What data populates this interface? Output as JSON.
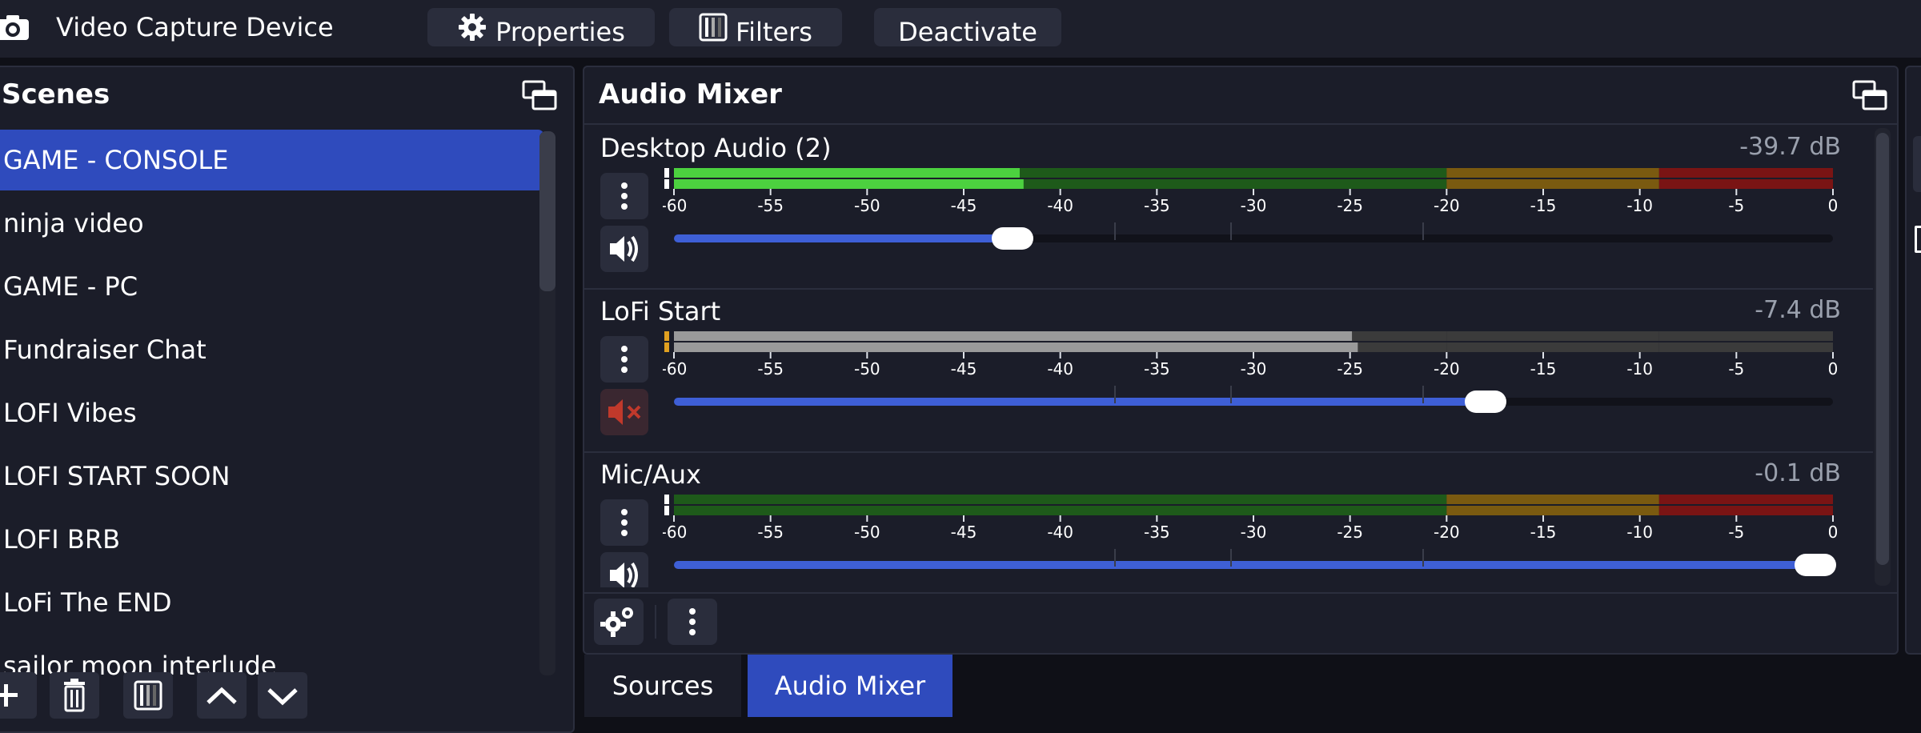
{
  "topbar": {
    "source_name": "Video Capture Device",
    "properties_label": "Properties",
    "filters_label": "Filters",
    "deactivate_label": "Deactivate"
  },
  "scenes": {
    "title": "Scenes",
    "items": [
      {
        "label": "GAME - CONSOLE",
        "selected": true
      },
      {
        "label": "ninja video",
        "selected": false
      },
      {
        "label": "GAME - PC",
        "selected": false
      },
      {
        "label": "Fundraiser Chat",
        "selected": false
      },
      {
        "label": "LOFI Vibes",
        "selected": false
      },
      {
        "label": "LOFI START SOON",
        "selected": false
      },
      {
        "label": "LOFI BRB",
        "selected": false
      },
      {
        "label": "LoFi The END",
        "selected": false
      },
      {
        "label": "sailor moon interlude",
        "selected": false
      }
    ]
  },
  "mixer": {
    "title": "Audio Mixer",
    "scale": [
      "-60",
      "-55",
      "-50",
      "-45",
      "-40",
      "-35",
      "-30",
      "-25",
      "-20",
      "-15",
      "-10",
      "-5",
      "0"
    ],
    "channels": [
      {
        "name": "Desktop Audio (2)",
        "db": "-39.7 dB",
        "muted": false,
        "level1_db": -42.1,
        "level2_db": -41.9,
        "volume_fraction": 0.292
      },
      {
        "name": "LoFi Start",
        "db": "-7.4 dB",
        "muted": true,
        "level1_db": -24.9,
        "level2_db": -24.6,
        "volume_fraction": 0.7
      },
      {
        "name": "Mic/Aux",
        "db": "-0.1 dB",
        "muted": false,
        "level1_db": -60,
        "level2_db": -60,
        "volume_fraction": 0.985
      }
    ]
  },
  "tabs": [
    {
      "label": "Sources",
      "active": false
    },
    {
      "label": "Audio Mixer",
      "active": true
    }
  ],
  "colors": {
    "accent": "#2f4bbd",
    "slider": "#3e5fd6",
    "meter_green_dim": "#1e5a1a",
    "meter_green": "#4cd13f",
    "meter_yellow_dim": "#7a5a10",
    "meter_red_dim": "#7a1414",
    "mute_red": "#c0392b"
  }
}
